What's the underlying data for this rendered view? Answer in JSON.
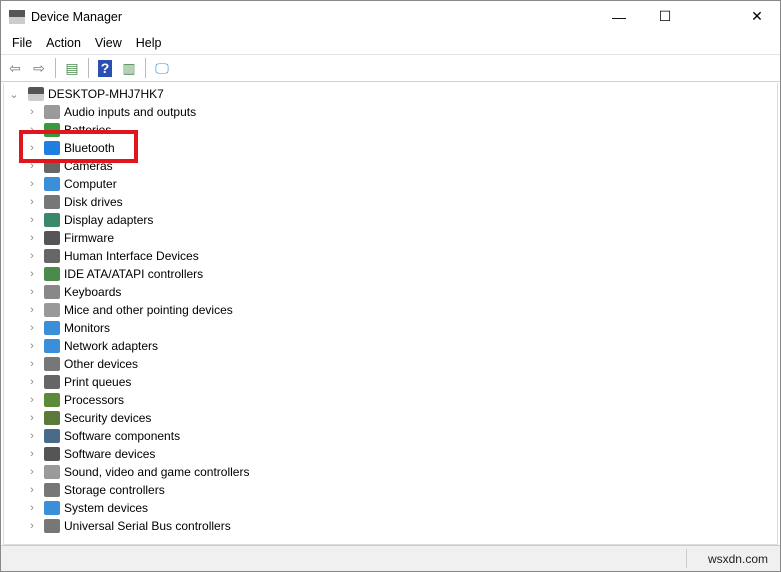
{
  "window": {
    "title": "Device Manager",
    "minimize": "—",
    "maximize": "☐",
    "close": "✕"
  },
  "menu": [
    "File",
    "Action",
    "View",
    "Help"
  ],
  "tree": {
    "root": "DESKTOP-MHJ7HK7",
    "items": [
      {
        "label": "Audio inputs and outputs",
        "color": "#9a9a9a"
      },
      {
        "label": "Batteries",
        "color": "#3a9a3a"
      },
      {
        "label": "Bluetooth",
        "color": "#1f7fe0"
      },
      {
        "label": "Cameras",
        "color": "#666666"
      },
      {
        "label": "Computer",
        "color": "#3a8fd8"
      },
      {
        "label": "Disk drives",
        "color": "#777777"
      },
      {
        "label": "Display adapters",
        "color": "#3a8a6a"
      },
      {
        "label": "Firmware",
        "color": "#555555"
      },
      {
        "label": "Human Interface Devices",
        "color": "#666666"
      },
      {
        "label": "IDE ATA/ATAPI controllers",
        "color": "#4a8a4a"
      },
      {
        "label": "Keyboards",
        "color": "#888888"
      },
      {
        "label": "Mice and other pointing devices",
        "color": "#999999"
      },
      {
        "label": "Monitors",
        "color": "#3a8fd8"
      },
      {
        "label": "Network adapters",
        "color": "#3a8fd8"
      },
      {
        "label": "Other devices",
        "color": "#777777"
      },
      {
        "label": "Print queues",
        "color": "#666666"
      },
      {
        "label": "Processors",
        "color": "#5a8a3a"
      },
      {
        "label": "Security devices",
        "color": "#5a7a3a"
      },
      {
        "label": "Software components",
        "color": "#4a6a8a"
      },
      {
        "label": "Software devices",
        "color": "#555555"
      },
      {
        "label": "Sound, video and game controllers",
        "color": "#9a9a9a"
      },
      {
        "label": "Storage controllers",
        "color": "#777777"
      },
      {
        "label": "System devices",
        "color": "#3a8fd8"
      },
      {
        "label": "Universal Serial Bus controllers",
        "color": "#777777"
      }
    ]
  },
  "highlight_color": "#e0161f",
  "status": {
    "watermark": "wsxdn.com"
  }
}
